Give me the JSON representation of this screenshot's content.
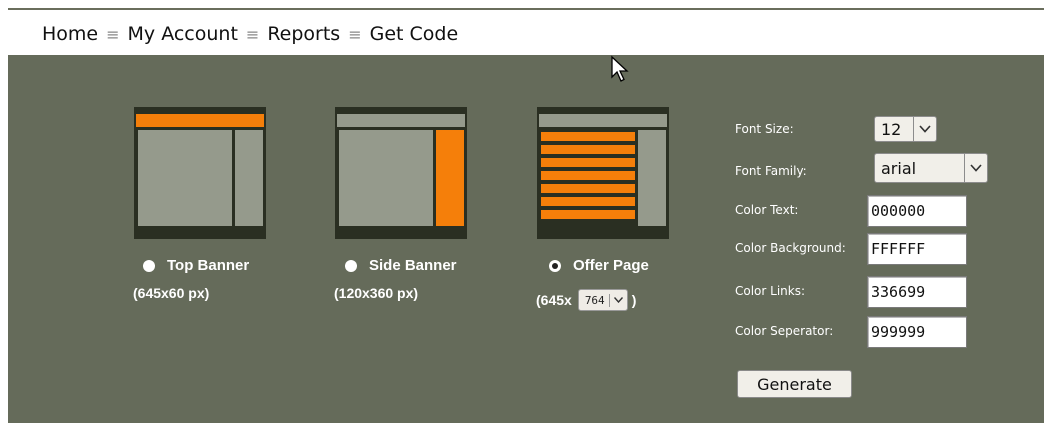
{
  "nav": {
    "items": [
      "Home",
      "My Account",
      "Reports",
      "Get Code"
    ],
    "separator": "≡"
  },
  "layouts": [
    {
      "name": "Top Banner",
      "size": "(645x60 px)",
      "selected": false
    },
    {
      "name": "Side Banner",
      "size": "(120x360 px)",
      "selected": false
    },
    {
      "name": "Offer Page",
      "size_prefix": "(645x",
      "size_value": "764",
      "size_suffix": ")",
      "selected": true
    }
  ],
  "form": {
    "font_size_label": "Font Size:",
    "font_size_value": "12",
    "font_family_label": "Font Family:",
    "font_family_value": "arial",
    "color_text_label": "Color Text:",
    "color_text_value": "000000",
    "color_background_label": "Color Background:",
    "color_background_value": "FFFFFF",
    "color_links_label": "Color Links:",
    "color_links_value": "336699",
    "color_separator_label": "Color Seperator:",
    "color_separator_value": "999999",
    "generate_label": "Generate"
  },
  "icons": {
    "chevron": "chevron-down-icon",
    "cursor": "mouse-pointer-icon"
  },
  "colors": {
    "panel": "#656b5a",
    "accent": "#f57f0a",
    "block": "#959a8c",
    "frame": "#2a2f22"
  }
}
